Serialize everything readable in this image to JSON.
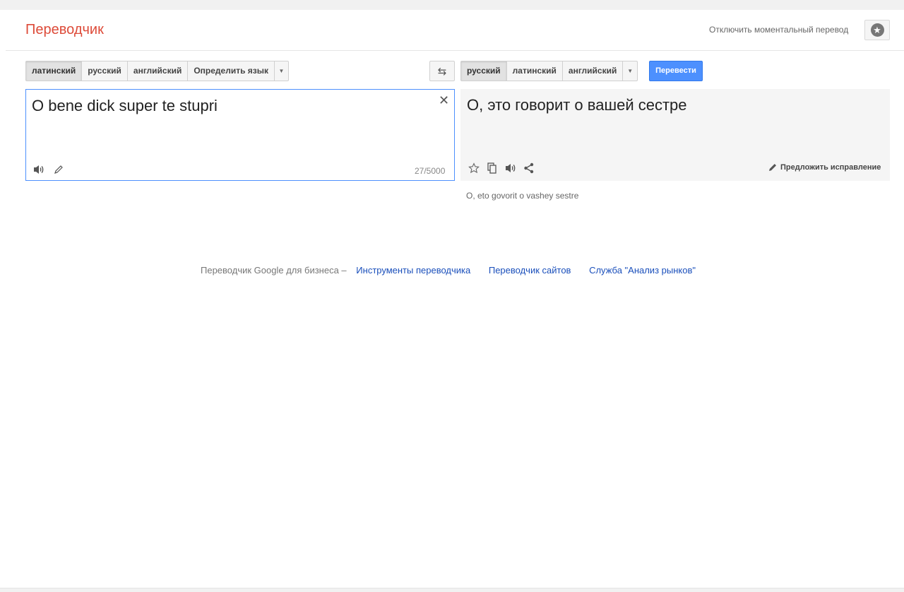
{
  "header": {
    "title": "Переводчик",
    "instant_toggle": "Отключить моментальный перевод"
  },
  "source": {
    "languages": [
      "латинский",
      "русский",
      "английский",
      "Определить язык"
    ],
    "selected": "латинский",
    "text": "O bene dick super te stupri",
    "char_count": "27/5000"
  },
  "target": {
    "languages": [
      "русский",
      "латинский",
      "английский"
    ],
    "selected": "русский",
    "text": "О, это говорит о вашей сестре",
    "transliteration": "O, eto govorit o vashey sestre",
    "suggest_label": "Предложить исправление"
  },
  "translate_button": "Перевести",
  "footer": {
    "prefix": "Переводчик Google для бизнеса –",
    "links": [
      "Инструменты переводчика",
      "Переводчик сайтов",
      "Служба \"Анализ рынков\""
    ]
  },
  "icons": {
    "settings": "star-icon",
    "swap": "swap-icon",
    "clear": "close-icon",
    "listen": "speaker-icon",
    "handwrite": "pencil-icon",
    "favorite": "star-outline-icon",
    "copy": "copy-icon",
    "share": "share-icon"
  }
}
